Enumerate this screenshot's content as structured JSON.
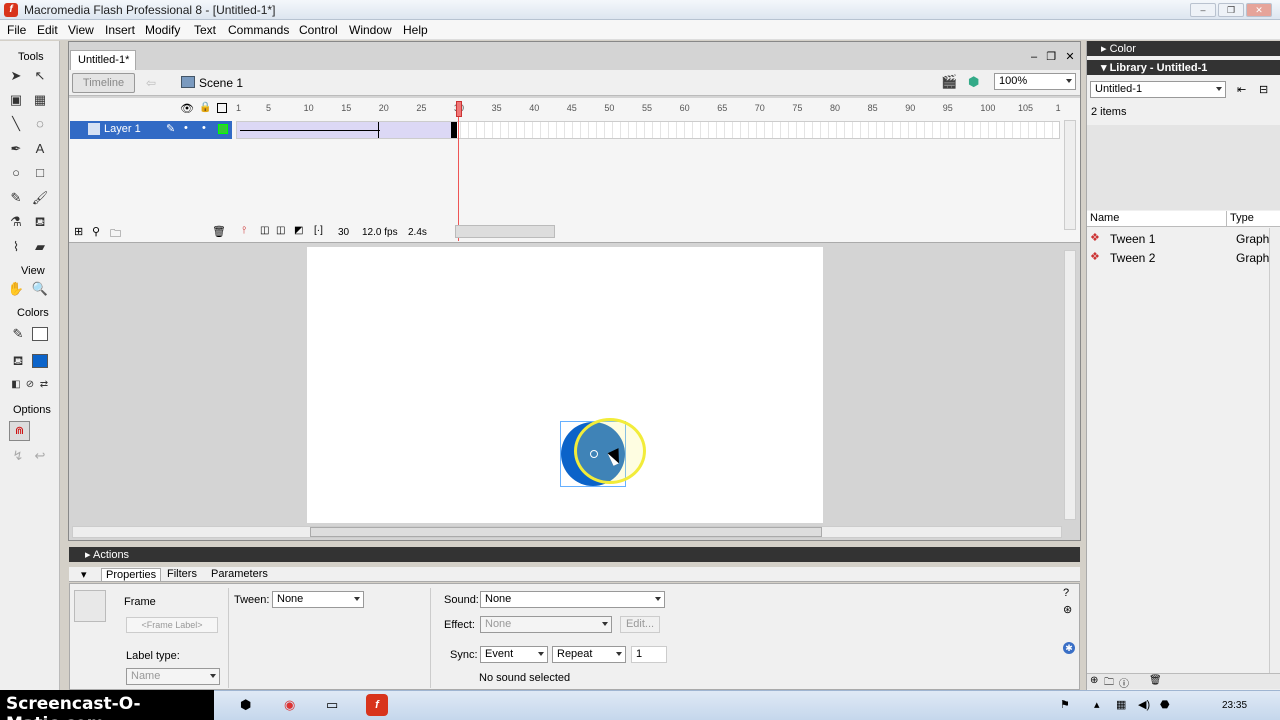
{
  "window": {
    "title": "Macromedia Flash Professional 8 - [Untitled-1*]",
    "app_icon_glyph": "f"
  },
  "menu": [
    "File",
    "Edit",
    "View",
    "Insert",
    "Modify",
    "Text",
    "Commands",
    "Control",
    "Window",
    "Help"
  ],
  "tools": {
    "title": "Tools",
    "view_label": "View",
    "colors_label": "Colors",
    "options_label": "Options"
  },
  "document": {
    "tab": "Untitled-1*",
    "timeline_button": "Timeline",
    "scene": "Scene 1",
    "zoom": "100%"
  },
  "timeline": {
    "layer_name": "Layer 1",
    "ruler_ticks": [
      "1",
      "5",
      "10",
      "15",
      "20",
      "25",
      "30",
      "35",
      "40",
      "45",
      "50",
      "55",
      "60",
      "65",
      "70",
      "75",
      "80",
      "85",
      "90",
      "95",
      "100",
      "105",
      "1"
    ],
    "current_frame": "30",
    "fps": "12.0 fps",
    "elapsed": "2.4s"
  },
  "panels": {
    "actions": "Actions",
    "properties_tab": "Properties",
    "filters_tab": "Filters",
    "parameters_tab": "Parameters"
  },
  "properties": {
    "type_label": "Frame",
    "frame_label_placeholder": "<Frame Label>",
    "tween_label": "Tween:",
    "tween_value": "None",
    "sound_label": "Sound:",
    "sound_value": "None",
    "effect_label": "Effect:",
    "effect_value": "None",
    "edit_button": "Edit...",
    "sync_label": "Sync:",
    "sync_value": "Event",
    "repeat_value": "Repeat",
    "repeat_count": "1",
    "no_sound": "No sound selected",
    "label_type_label": "Label type:",
    "label_type_value": "Name"
  },
  "library": {
    "color_panel": "Color",
    "title": "Library - Untitled-1",
    "doc_select": "Untitled-1",
    "count": "2 items",
    "col_name": "Name",
    "col_type": "Type",
    "items": [
      {
        "name": "Tween 1",
        "type": "Graph"
      },
      {
        "name": "Tween 2",
        "type": "Graph"
      }
    ]
  },
  "taskbar": {
    "watermark": "Screencast-O-Matic.com",
    "clock": "23:35"
  },
  "colors": {
    "selection": "#316ac5",
    "fill": "#0b63c9",
    "highlight": "#f2ec3a"
  }
}
